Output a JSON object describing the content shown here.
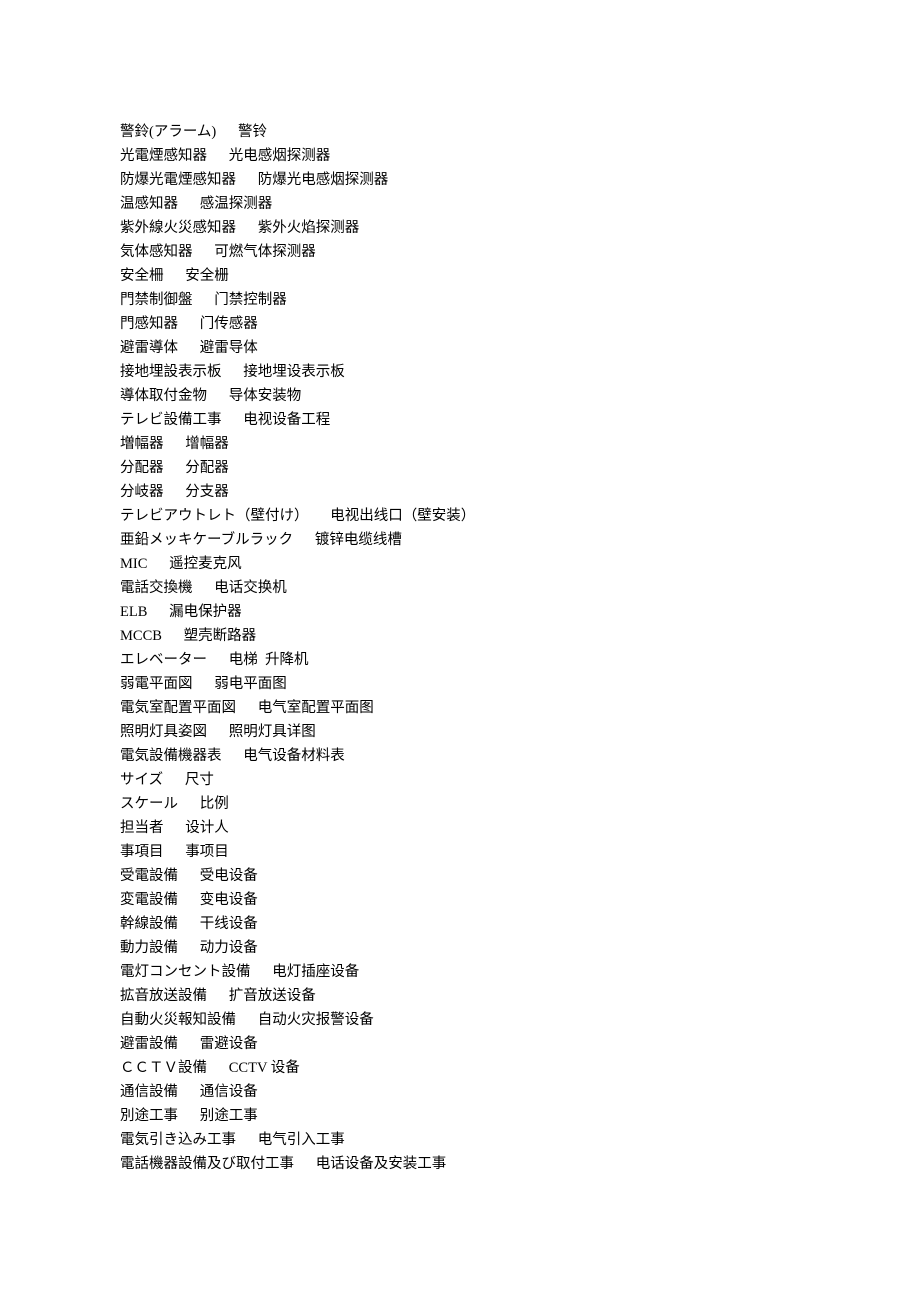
{
  "entries": [
    {
      "jp": "警鈴(アラーム)",
      "sep": "      ",
      "cn": "警铃"
    },
    {
      "jp": "光電煙感知器",
      "sep": "      ",
      "cn": "光电感烟探测器"
    },
    {
      "jp": "防爆光電煙感知器",
      "sep": "      ",
      "cn": "防爆光电感烟探测器"
    },
    {
      "jp": "温感知器",
      "sep": "      ",
      "cn": "感温探测器"
    },
    {
      "jp": "紫外線火災感知器",
      "sep": "      ",
      "cn": "紫外火焰探测器"
    },
    {
      "jp": "気体感知器",
      "sep": "      ",
      "cn": "可燃气体探测器"
    },
    {
      "jp": "安全柵",
      "sep": "      ",
      "cn": "安全栅"
    },
    {
      "jp": "門禁制御盤",
      "sep": "      ",
      "cn": "门禁控制器"
    },
    {
      "jp": "門感知器",
      "sep": "      ",
      "cn": "门传感器"
    },
    {
      "jp": "避雷導体",
      "sep": "      ",
      "cn": "避雷导体"
    },
    {
      "jp": "接地埋設表示板",
      "sep": "      ",
      "cn": "接地埋设表示板"
    },
    {
      "jp": "導体取付金物",
      "sep": "      ",
      "cn": "导体安装物"
    },
    {
      "jp": "テレビ設備工事",
      "sep": "      ",
      "cn": "电视设备工程"
    },
    {
      "jp": "増幅器",
      "sep": "      ",
      "cn": "增幅器"
    },
    {
      "jp": "分配器",
      "sep": "      ",
      "cn": "分配器"
    },
    {
      "jp": "分岐器",
      "sep": "      ",
      "cn": "分支器"
    },
    {
      "jp": "テレビアウトレト（壁付け）",
      "sep": "      ",
      "cn": "电视出线口（壁安装）"
    },
    {
      "jp": "亜鉛メッキケーブルラック",
      "sep": "      ",
      "cn": "镀锌电缆线槽"
    },
    {
      "jp": "MIC",
      "sep": "      ",
      "cn": "遥控麦克风"
    },
    {
      "jp": "電話交換機",
      "sep": "      ",
      "cn": "电话交换机"
    },
    {
      "jp": "ELB",
      "sep": "      ",
      "cn": "漏电保护器"
    },
    {
      "jp": "MCCB",
      "sep": "      ",
      "cn": "塑壳断路器"
    },
    {
      "jp": "エレベーター",
      "sep": "      ",
      "cn": "电梯  升降机"
    },
    {
      "jp": "弱電平面図",
      "sep": "      ",
      "cn": "弱电平面图"
    },
    {
      "jp": "電気室配置平面図",
      "sep": "      ",
      "cn": "电气室配置平面图"
    },
    {
      "jp": "照明灯具姿図",
      "sep": "      ",
      "cn": "照明灯具详图"
    },
    {
      "jp": "電気設備機器表",
      "sep": "      ",
      "cn": "电气设备材料表"
    },
    {
      "jp": "サイズ",
      "sep": "      ",
      "cn": "尺寸"
    },
    {
      "jp": "スケール",
      "sep": "      ",
      "cn": "比例"
    },
    {
      "jp": "担当者",
      "sep": "      ",
      "cn": "设计人"
    },
    {
      "jp": "事項目",
      "sep": "      ",
      "cn": "事项目"
    },
    {
      "jp": "受電設備",
      "sep": "      ",
      "cn": "受电设备"
    },
    {
      "jp": "変電設備",
      "sep": "      ",
      "cn": "变电设备"
    },
    {
      "jp": "幹線設備",
      "sep": "      ",
      "cn": "干线设备"
    },
    {
      "jp": "動力設備",
      "sep": "      ",
      "cn": "动力设备"
    },
    {
      "jp": "電灯コンセント設備",
      "sep": "      ",
      "cn": "电灯插座设备"
    },
    {
      "jp": "拡音放送設備",
      "sep": "      ",
      "cn": "扩音放送设备"
    },
    {
      "jp": "自動火災報知設備",
      "sep": "      ",
      "cn": "自动火灾报警设备"
    },
    {
      "jp": "避雷設備",
      "sep": "      ",
      "cn": "雷避设备"
    },
    {
      "jp": "ＣＣＴＶ設備",
      "sep": "      ",
      "cn": "CCTV 设备"
    },
    {
      "jp": "通信設備",
      "sep": "      ",
      "cn": "通信设备"
    },
    {
      "jp": "別途工事",
      "sep": "      ",
      "cn": "别途工事"
    },
    {
      "jp": "電気引き込み工事",
      "sep": "      ",
      "cn": "电气引入工事"
    },
    {
      "jp": "電話機器設備及び取付工事",
      "sep": "      ",
      "cn": "电话设备及安装工事"
    }
  ]
}
